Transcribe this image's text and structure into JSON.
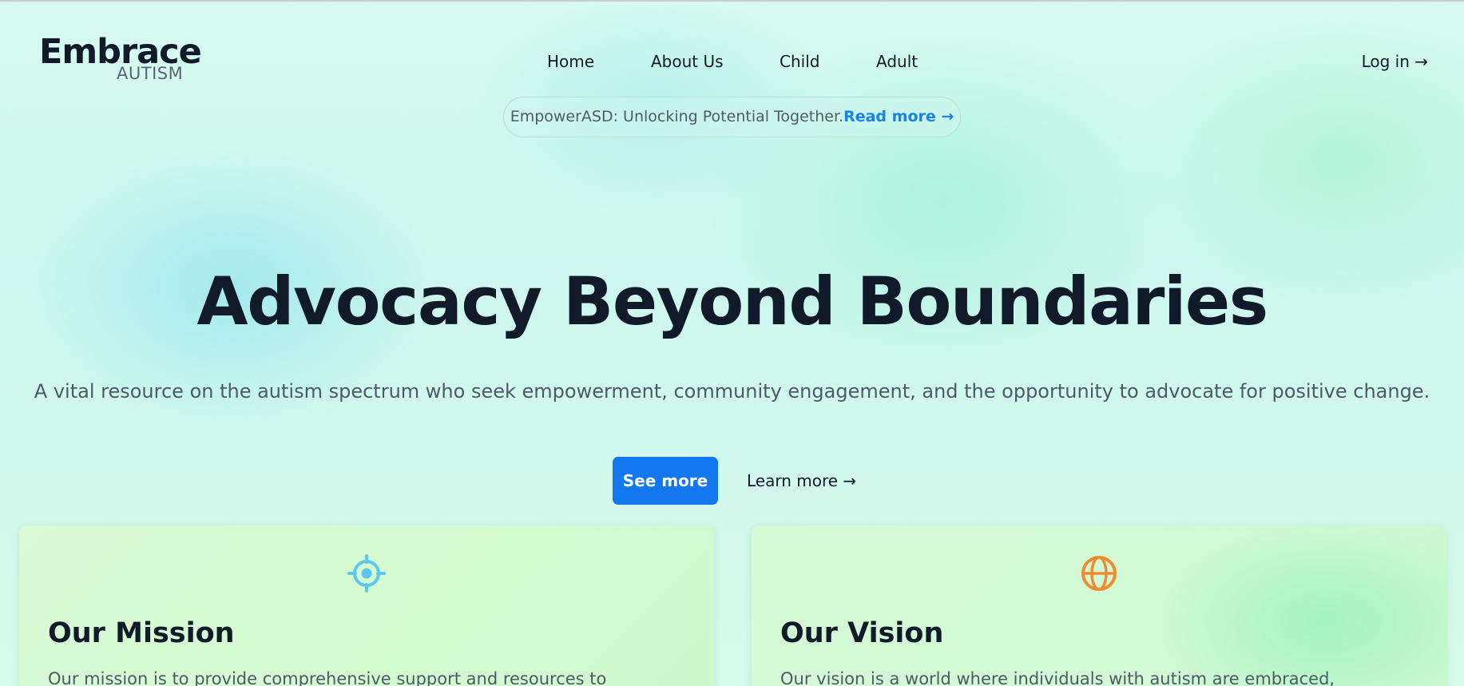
{
  "brand": {
    "name": "Embrace",
    "tagline": "AUTISM"
  },
  "nav": {
    "items": [
      {
        "label": "Home"
      },
      {
        "label": "About Us"
      },
      {
        "label": "Child"
      },
      {
        "label": "Adult"
      }
    ],
    "login_label": "Log in →"
  },
  "announcement": {
    "message": "EmpowerASD: Unlocking Potential Together.",
    "link_label": "Read more →"
  },
  "hero": {
    "title": "Advocacy Beyond Boundaries",
    "subtitle": "A vital resource on the autism spectrum who seek empowerment, community engagement, and the opportunity to advocate for positive change.",
    "primary_button": "See more",
    "secondary_link": "Learn more →"
  },
  "cards": [
    {
      "icon": "target-icon",
      "title": "Our Mission",
      "text": "Our mission is to provide comprehensive support and resources to"
    },
    {
      "icon": "globe-icon",
      "title": "Our Vision",
      "text": "Our vision is a world where individuals with autism are embraced,"
    }
  ],
  "colors": {
    "accent": "#1378f0",
    "link": "#1a82e8",
    "mission_icon": "#5cc8f0",
    "vision_icon": "#f28a2e",
    "text_dark": "#111a28",
    "text_muted": "#4e5968"
  }
}
